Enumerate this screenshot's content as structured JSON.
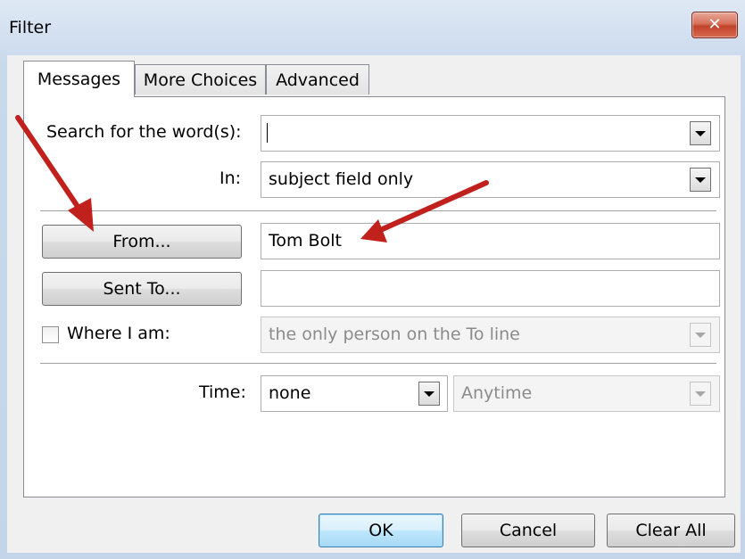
{
  "window": {
    "title": "Filter",
    "close_glyph": "✕"
  },
  "tabs": [
    {
      "label": "Messages",
      "active": true
    },
    {
      "label": "More Choices",
      "active": false
    },
    {
      "label": "Advanced",
      "active": false
    }
  ],
  "search": {
    "label": "Search for the word(s):",
    "value": ""
  },
  "in_field": {
    "label": "In:",
    "value": "subject field only"
  },
  "from": {
    "button_label": "From...",
    "value": "Tom Bolt"
  },
  "sent_to": {
    "button_label": "Sent To...",
    "value": ""
  },
  "where_i_am": {
    "label": "Where I am:",
    "checked": false,
    "value": "the only person on the To line"
  },
  "time": {
    "label": "Time:",
    "value": "none",
    "range_value": "Anytime"
  },
  "buttons": {
    "ok": "OK",
    "cancel": "Cancel",
    "clear_all": "Clear All"
  },
  "annotation_colors": {
    "arrow": "#c0211d"
  },
  "icons": {
    "close": "close-icon",
    "dropdown": "chevron-down-icon",
    "annotation": "arrow-icon"
  }
}
